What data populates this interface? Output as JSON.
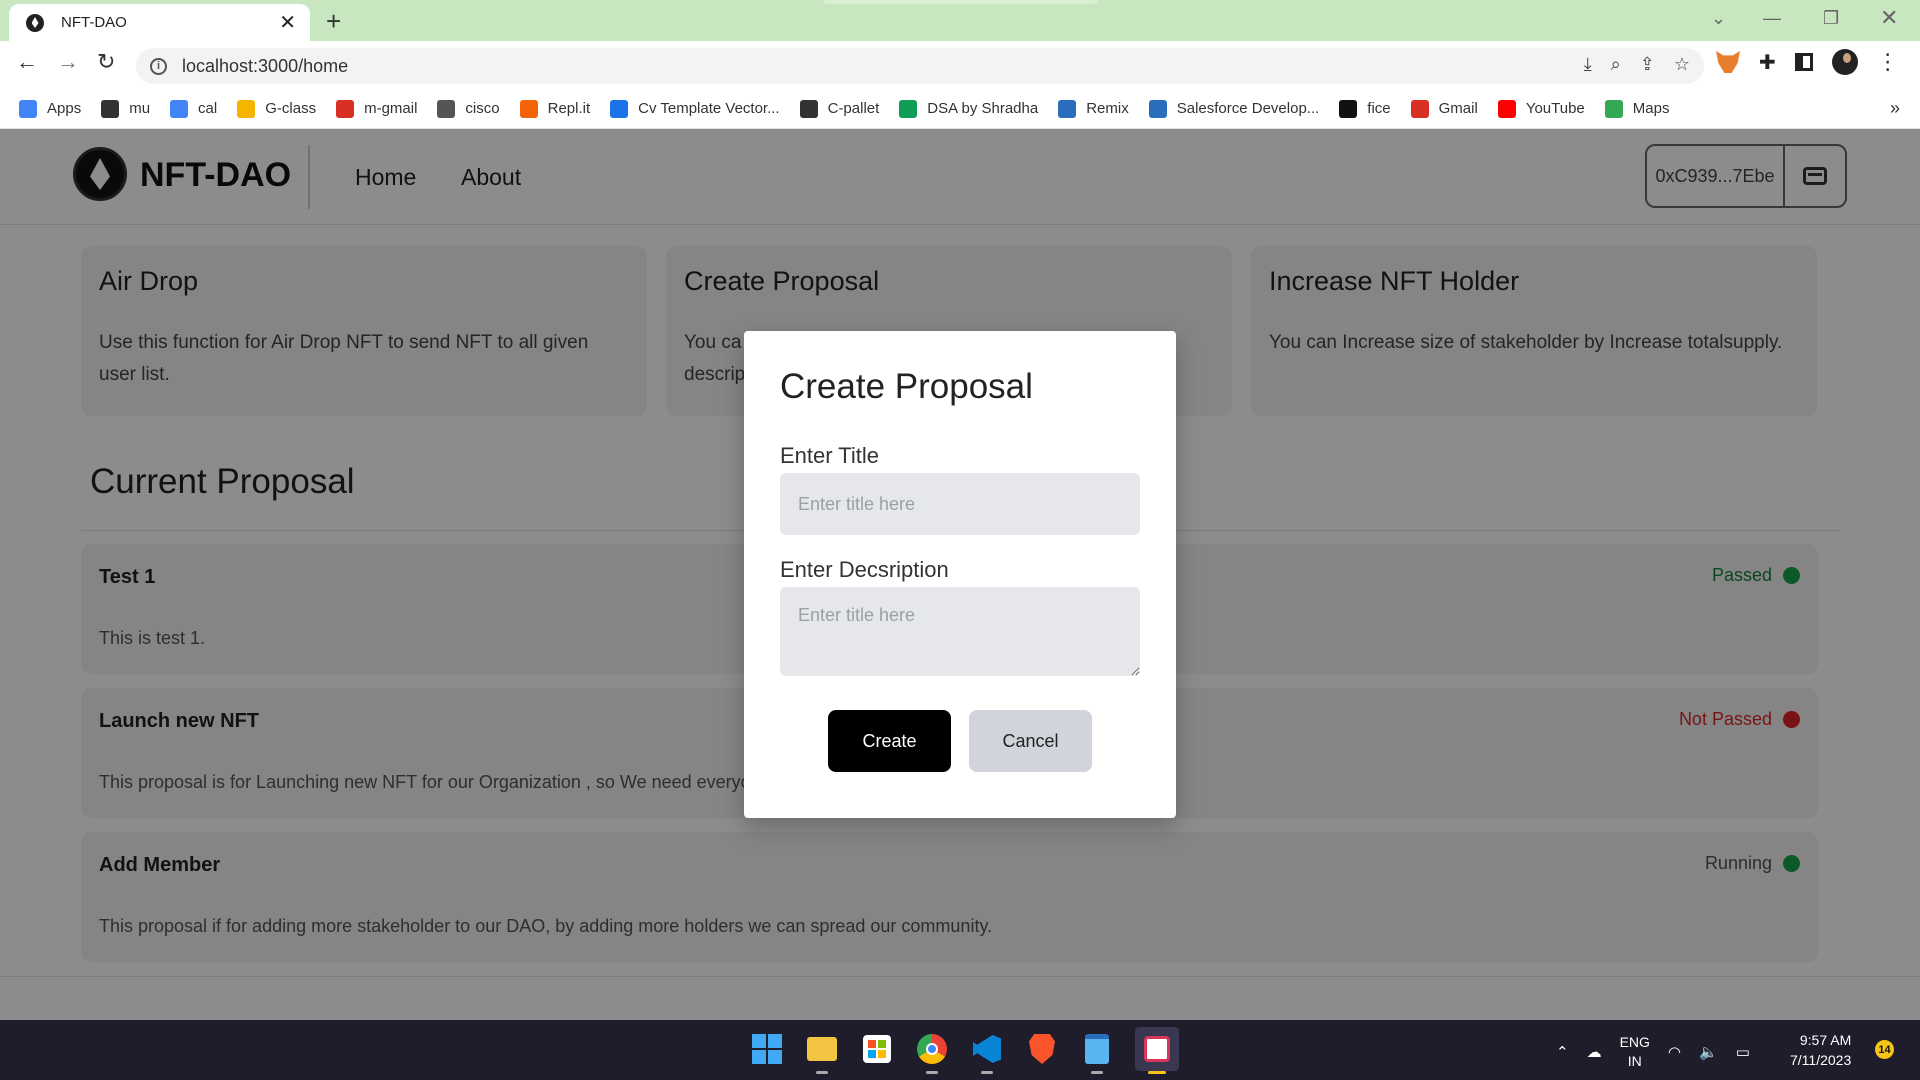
{
  "browser": {
    "tab_title": "NFT-DAO",
    "url": "localhost:3000/home",
    "bookmarks": [
      {
        "label": "Apps",
        "icon": "apps-grid-icon",
        "color": "#4285f4"
      },
      {
        "label": "mu",
        "icon": "globe-icon",
        "color": "#333333"
      },
      {
        "label": "cal",
        "icon": "google-icon",
        "color": "#4285f4"
      },
      {
        "label": "G-class",
        "icon": "classroom-icon",
        "color": "#f4b400"
      },
      {
        "label": "m-gmail",
        "icon": "gmail-icon",
        "color": "#d93025"
      },
      {
        "label": "cisco",
        "icon": "cisco-icon",
        "color": "#555555"
      },
      {
        "label": "Repl.it",
        "icon": "replit-icon",
        "color": "#f26207"
      },
      {
        "label": "Cv Template Vector...",
        "icon": "vector-icon",
        "color": "#1a73e8"
      },
      {
        "label": "C-pallet",
        "icon": "cpallet-icon",
        "color": "#333333"
      },
      {
        "label": "DSA by Shradha",
        "icon": "sheets-icon",
        "color": "#0f9d58"
      },
      {
        "label": "Remix",
        "icon": "remix-icon",
        "color": "#2a6ebb"
      },
      {
        "label": "Salesforce Develop...",
        "icon": "salesforce-icon",
        "color": "#2a6ebb"
      },
      {
        "label": "fice",
        "icon": "medium-icon",
        "color": "#111111"
      },
      {
        "label": "Gmail",
        "icon": "gmail-icon",
        "color": "#d93025"
      },
      {
        "label": "YouTube",
        "icon": "youtube-icon",
        "color": "#ff0000"
      },
      {
        "label": "Maps",
        "icon": "maps-icon",
        "color": "#34a853"
      }
    ]
  },
  "app": {
    "brand": "NFT-DAO",
    "nav": [
      "Home",
      "About"
    ],
    "wallet_address": "0xC939...7Ebe"
  },
  "cards": [
    {
      "title": "Air Drop",
      "desc": "Use this function for Air Drop NFT to send NFT to all given user list."
    },
    {
      "title": "Create Proposal",
      "desc": "You ca descrip"
    },
    {
      "title": "Increase NFT Holder",
      "desc": "You can Increase size of stakeholder by Increase totalsupply."
    }
  ],
  "section_title": "Current Proposal",
  "proposals": [
    {
      "title": "Test 1",
      "desc": "This is test 1.",
      "status": "Passed",
      "status_color": "#15803d",
      "dot_color": "#16a34a"
    },
    {
      "title": "Launch new NFT",
      "desc": "This proposal is for Launching new NFT for our Organization , so We need everyo",
      "status": "Not Passed",
      "status_color": "#dc2626",
      "dot_color": "#dc2626"
    },
    {
      "title": "Add Member",
      "desc": "This proposal if for adding more stakeholder to our DAO, by adding more holders we can spread our community.",
      "status": "Running",
      "status_color": "#555555",
      "dot_color": "#16a34a"
    }
  ],
  "modal": {
    "title": "Create Proposal",
    "title_label": "Enter Title",
    "title_placeholder": "Enter title here",
    "desc_label": "Enter Decsription",
    "desc_placeholder": "Enter title here",
    "create_label": "Create",
    "cancel_label": "Cancel"
  },
  "taskbar": {
    "apps": [
      "windows-start-icon",
      "file-explorer-icon",
      "store-icon",
      "chrome-icon",
      "vscode-icon",
      "brave-icon",
      "notepad-icon",
      "snipping-tool-icon"
    ],
    "lang_top": "ENG",
    "lang_bottom": "IN",
    "time": "9:57 AM",
    "date": "7/11/2023",
    "notification_count": "14"
  }
}
